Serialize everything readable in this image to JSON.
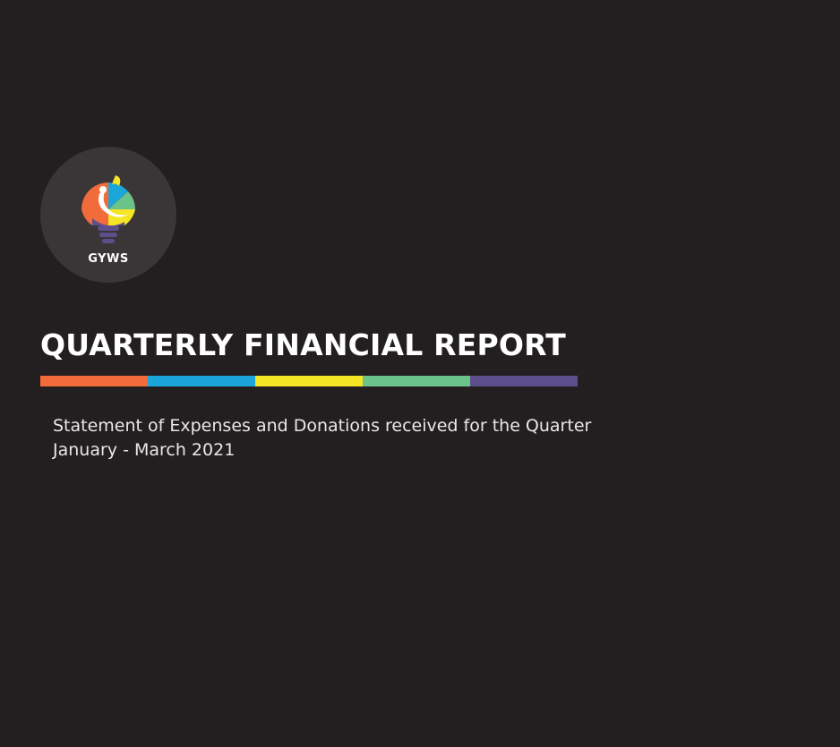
{
  "logo": {
    "text": "GYWS",
    "icon": "lightbulb-icon"
  },
  "title": "QUARTERLY FINANCIAL REPORT",
  "color_bar": {
    "colors": [
      "#f26b3a",
      "#1ba6d9",
      "#f4e525",
      "#6cc38a",
      "#5c4f8b"
    ]
  },
  "subtitle": {
    "line1": "Statement of Expenses and Donations received for the Quarter",
    "line2": "January - March 2021"
  },
  "colors": {
    "background": "#231f20",
    "logo_circle": "#3a3637",
    "text": "#ffffff"
  }
}
